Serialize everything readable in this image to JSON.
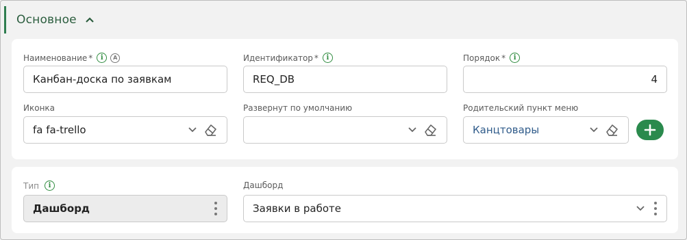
{
  "section": {
    "title": "Основное"
  },
  "fields": {
    "name": {
      "label": "Наименование",
      "required": "*",
      "value": "Канбан-доска по заявкам",
      "lang_badge": "A"
    },
    "identifier": {
      "label": "Идентификатор",
      "required": "*",
      "value": "REQ_DB"
    },
    "order": {
      "label": "Порядок",
      "required": "*",
      "value": "4"
    },
    "icon": {
      "label": "Иконка",
      "value": "fa fa-trello"
    },
    "expanded": {
      "label": "Развернут по умолчанию",
      "value": ""
    },
    "parent": {
      "label": "Родительский пункт меню",
      "value": "Канцтовары"
    },
    "type": {
      "label": "Тип",
      "value": "Дашборд"
    },
    "dashboard": {
      "label": "Дашборд",
      "value": "Заявки в работе"
    }
  },
  "info_glyph": "i",
  "colors": {
    "accent": "#2e7d4f",
    "link": "#2f5b8a",
    "add_button": "#2a8a4d"
  }
}
